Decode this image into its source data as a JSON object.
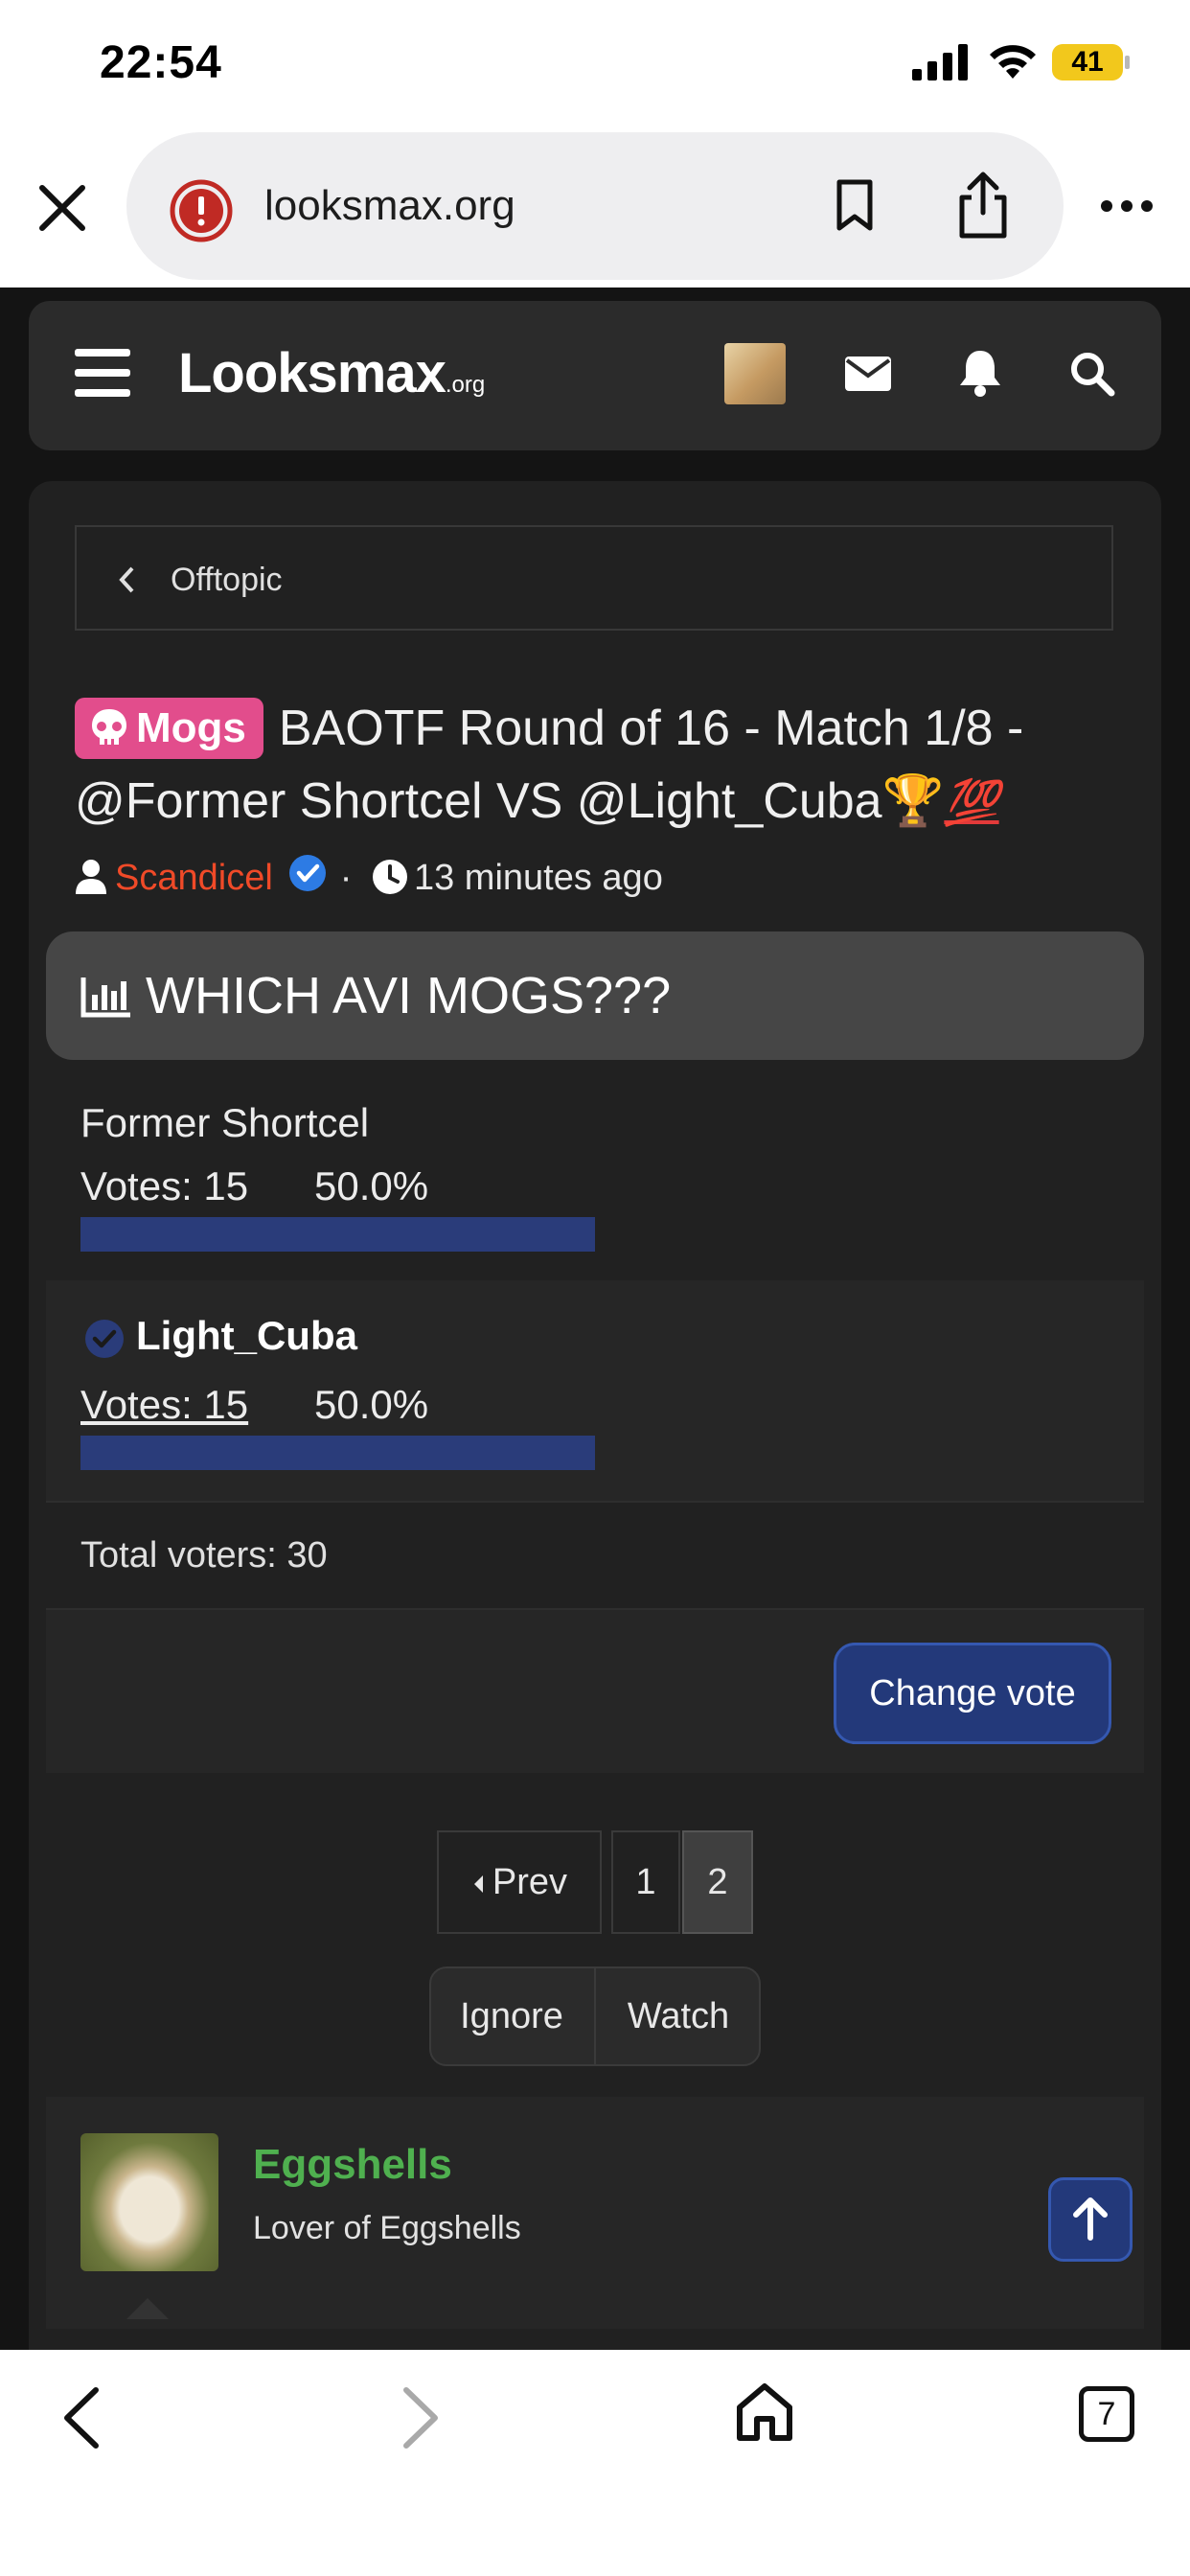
{
  "status_bar": {
    "time": "22:54",
    "battery": "41"
  },
  "browser": {
    "url": "looksmax.org",
    "tab_count": "7"
  },
  "site": {
    "logo_main": "Looksmax",
    "logo_sub": ".org"
  },
  "breadcrumb": {
    "label": "Offtopic"
  },
  "thread": {
    "prefix": "Mogs",
    "title_line1": "BAOTF Round of 16 - Match 1/8 -",
    "title_line2": "@Former Shortcel VS @Light_Cuba",
    "title_emoji_trophy": "🏆",
    "title_emoji_100": "💯",
    "author": "Scandicel",
    "separator": "·",
    "time_ago": "13 minutes ago"
  },
  "poll": {
    "question": "WHICH AVI MOGS???",
    "options": [
      {
        "name": "Former Shortcel",
        "votes": "Votes: 15",
        "percent": "50.0%",
        "share": 0.5
      },
      {
        "name": "Light_Cuba",
        "votes": "Votes: 15",
        "percent": "50.0%",
        "share": 0.5
      }
    ],
    "total": "Total voters: 30",
    "change_vote_label": "Change vote"
  },
  "pagination": {
    "prev_label": "Prev",
    "pages": [
      "1",
      "2"
    ],
    "current": "2"
  },
  "thread_actions": {
    "ignore_label": "Ignore",
    "watch_label": "Watch"
  },
  "post": {
    "username": "Eggshells",
    "user_title": "Lover of Eggshells"
  },
  "colors": {
    "accent_blue": "#23397a",
    "prefix_pink": "#e24d8c",
    "author_red": "#f04a28",
    "username_green": "#4fb04f"
  }
}
